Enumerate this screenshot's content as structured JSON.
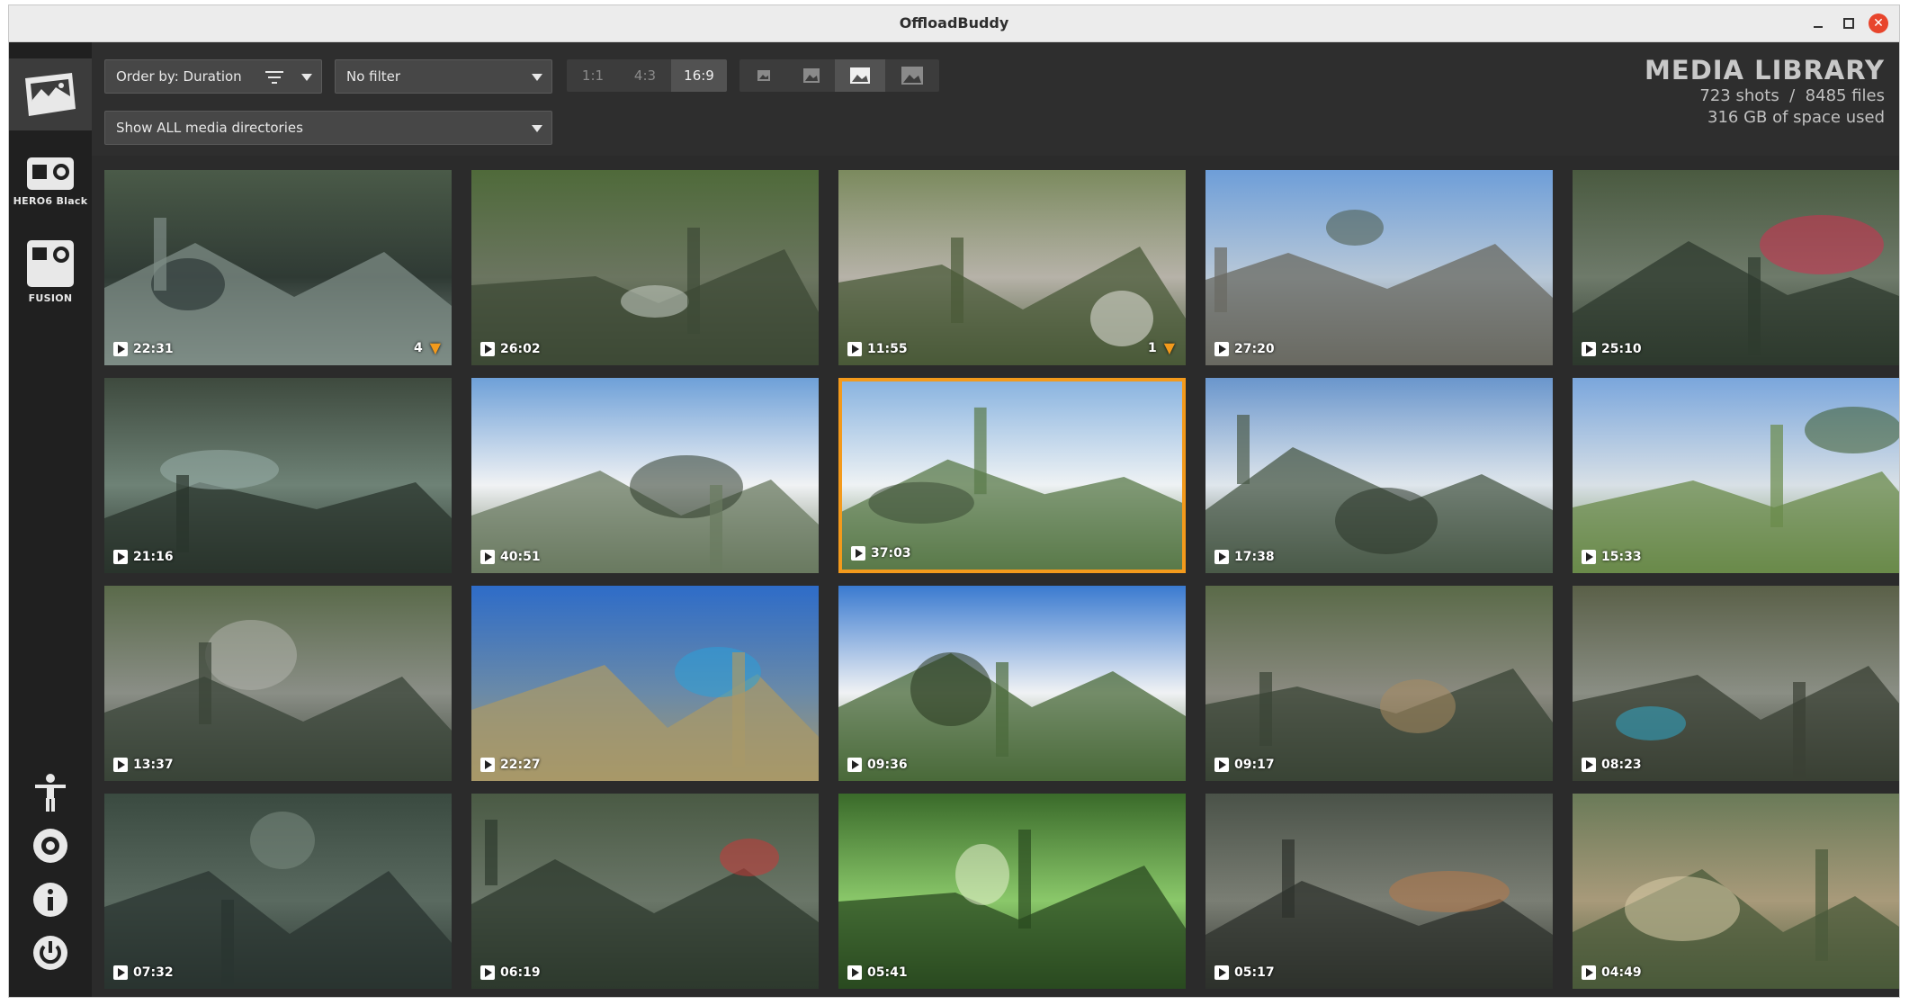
{
  "window": {
    "title": "OffloadBuddy"
  },
  "sidebar": {
    "cameras": [
      {
        "label": "HERO6 Black"
      },
      {
        "label": "FUSION"
      }
    ],
    "bottom_icons": [
      "accessibility-icon",
      "settings-icon",
      "info-icon",
      "power-icon"
    ]
  },
  "toolbar": {
    "order_by": "Order by: Duration",
    "filter": "No filter",
    "directories": "Show ALL media directories",
    "aspect_ratios": [
      "1:1",
      "4:3",
      "16:9"
    ],
    "aspect_selected": "16:9",
    "thumb_sizes": [
      "thumb-size-xs-icon",
      "thumb-size-s-icon",
      "thumb-size-m-icon",
      "thumb-size-l-icon"
    ],
    "thumb_size_selected": 2
  },
  "library": {
    "title": "MEDIA LIBRARY",
    "shots_files": "723 shots  /  8485 files",
    "space": "316 GB of space used"
  },
  "colors": {
    "accent": "#f39a1c",
    "background": "#2b2b2b",
    "sidebar": "#202020"
  },
  "media": [
    {
      "duration": "22:31",
      "highlights": "4",
      "scene": "canyon-wetsuit"
    },
    {
      "duration": "26:02",
      "highlights": "",
      "scene": "canyon-rope"
    },
    {
      "duration": "11:55",
      "highlights": "1",
      "scene": "cliff-via-ferrata"
    },
    {
      "duration": "27:20",
      "highlights": "",
      "scene": "paraglide-cliff"
    },
    {
      "duration": "25:10",
      "highlights": "",
      "scene": "canyon-helmet"
    },
    {
      "duration": "21:16",
      "highlights": "",
      "scene": "waterfall-gorge"
    },
    {
      "duration": "40:51",
      "highlights": "",
      "scene": "paraglide-mountains"
    },
    {
      "duration": "37:03",
      "highlights": "",
      "scene": "paraglide-valley",
      "selected": true
    },
    {
      "duration": "17:38",
      "highlights": "",
      "scene": "paraglide-clouds"
    },
    {
      "duration": "15:33",
      "highlights": "",
      "scene": "paraglide-forest"
    },
    {
      "duration": "13:37",
      "highlights": "",
      "scene": "rock-wall"
    },
    {
      "duration": "22:27",
      "highlights": "",
      "scene": "launch-field"
    },
    {
      "duration": "09:36",
      "highlights": "",
      "scene": "paraglide-peaks"
    },
    {
      "duration": "09:17",
      "highlights": "",
      "scene": "canyon-log"
    },
    {
      "duration": "08:23",
      "highlights": "",
      "scene": "canyon-climber"
    },
    {
      "duration": "07:32",
      "highlights": "",
      "scene": "blurry-water"
    },
    {
      "duration": "06:19",
      "highlights": "",
      "scene": "canyon-red-pack"
    },
    {
      "duration": "05:41",
      "highlights": "",
      "scene": "forest-canopy"
    },
    {
      "duration": "05:17",
      "highlights": "",
      "scene": "canyon-walker"
    },
    {
      "duration": "04:49",
      "highlights": "",
      "scene": "wooden-fence"
    }
  ]
}
